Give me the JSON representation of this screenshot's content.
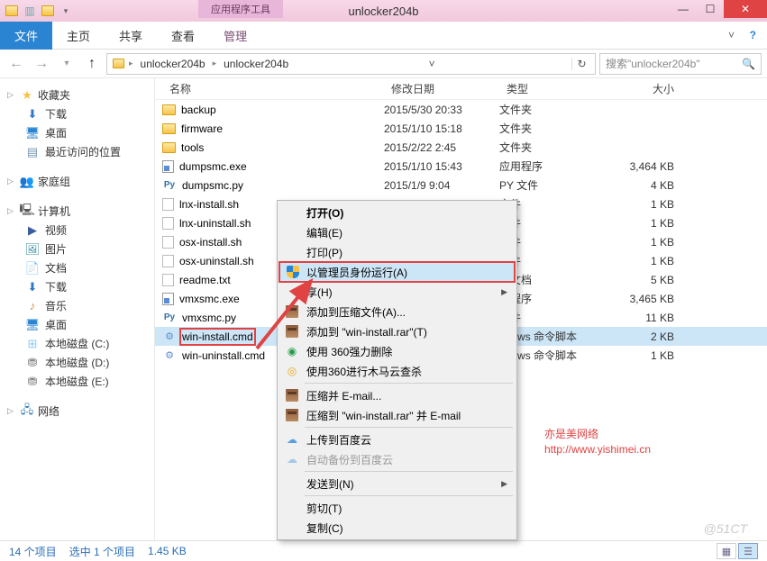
{
  "titlebar": {
    "tools_tab": "应用程序工具",
    "title": "unlocker204b"
  },
  "ribbon": {
    "file": "文件",
    "home": "主页",
    "share": "共享",
    "view": "查看",
    "manage": "管理"
  },
  "breadcrumb": {
    "parts": [
      "unlocker204b",
      "unlocker204b"
    ]
  },
  "search": {
    "placeholder": "搜索\"unlocker204b\""
  },
  "nav": {
    "favorites": "收藏夹",
    "downloads": "下载",
    "desktop": "桌面",
    "recent": "最近访问的位置",
    "homegroup": "家庭组",
    "computer": "计算机",
    "videos": "视频",
    "pictures": "图片",
    "documents": "文档",
    "downloads2": "下载",
    "music": "音乐",
    "desktop2": "桌面",
    "diskC": "本地磁盘 (C:)",
    "diskD": "本地磁盘 (D:)",
    "diskE": "本地磁盘 (E:)",
    "network": "网络"
  },
  "columns": {
    "name": "名称",
    "date": "修改日期",
    "type": "类型",
    "size": "大小"
  },
  "files": [
    {
      "name": "backup",
      "date": "2015/5/30 20:33",
      "type": "文件夹",
      "size": "",
      "icon": "folder"
    },
    {
      "name": "firmware",
      "date": "2015/1/10 15:18",
      "type": "文件夹",
      "size": "",
      "icon": "folder"
    },
    {
      "name": "tools",
      "date": "2015/2/22 2:45",
      "type": "文件夹",
      "size": "",
      "icon": "folder"
    },
    {
      "name": "dumpsmc.exe",
      "date": "2015/1/10 15:43",
      "type": "应用程序",
      "size": "3,464 KB",
      "icon": "exe"
    },
    {
      "name": "dumpsmc.py",
      "date": "2015/1/9 9:04",
      "type": "PY 文件",
      "size": "4 KB",
      "icon": "py"
    },
    {
      "name": "lnx-install.sh",
      "date": "",
      "type": "文件",
      "size": "1 KB",
      "icon": "sh"
    },
    {
      "name": "lnx-uninstall.sh",
      "date": "",
      "type": "文件",
      "size": "1 KB",
      "icon": "sh"
    },
    {
      "name": "osx-install.sh",
      "date": "",
      "type": "文件",
      "size": "1 KB",
      "icon": "sh"
    },
    {
      "name": "osx-uninstall.sh",
      "date": "",
      "type": "文件",
      "size": "1 KB",
      "icon": "sh"
    },
    {
      "name": "readme.txt",
      "date": "",
      "type": "本文档",
      "size": "5 KB",
      "icon": "txt"
    },
    {
      "name": "vmxsmc.exe",
      "date": "",
      "type": "用程序",
      "size": "3,465 KB",
      "icon": "exe"
    },
    {
      "name": "vmxsmc.py",
      "date": "",
      "type": "文件",
      "size": "11 KB",
      "icon": "py"
    },
    {
      "name": "win-install.cmd",
      "date": "",
      "type": "ndows 命令脚本",
      "size": "2 KB",
      "icon": "cmd",
      "selected": true
    },
    {
      "name": "win-uninstall.cmd",
      "date": "",
      "type": "ndows 命令脚本",
      "size": "1 KB",
      "icon": "cmd"
    }
  ],
  "context_menu": {
    "open": "打开(O)",
    "edit": "编辑(E)",
    "print": "打印(P)",
    "run_admin": "以管理员身份运行(A)",
    "share": "享(H)",
    "add_archive": "添加到压缩文件(A)...",
    "add_rar": "添加到 \"win-install.rar\"(T)",
    "force_del": "使用 360强力删除",
    "trojan_scan": "使用360进行木马云查杀",
    "email_archive": "压缩并 E-mail...",
    "email_rar": "压缩到 \"win-install.rar\" 并 E-mail",
    "upload_baidu": "上传到百度云",
    "auto_backup": "自动备份到百度云",
    "send_to": "发送到(N)",
    "cut": "剪切(T)",
    "copy": "复制(C)"
  },
  "status": {
    "count": "14 个项目",
    "selected": "选中 1 个项目",
    "size": "1.45 KB"
  },
  "annotation": {
    "line1": "亦是美网络",
    "line2": "http://www.yishimei.cn"
  },
  "watermark": "@51CT"
}
